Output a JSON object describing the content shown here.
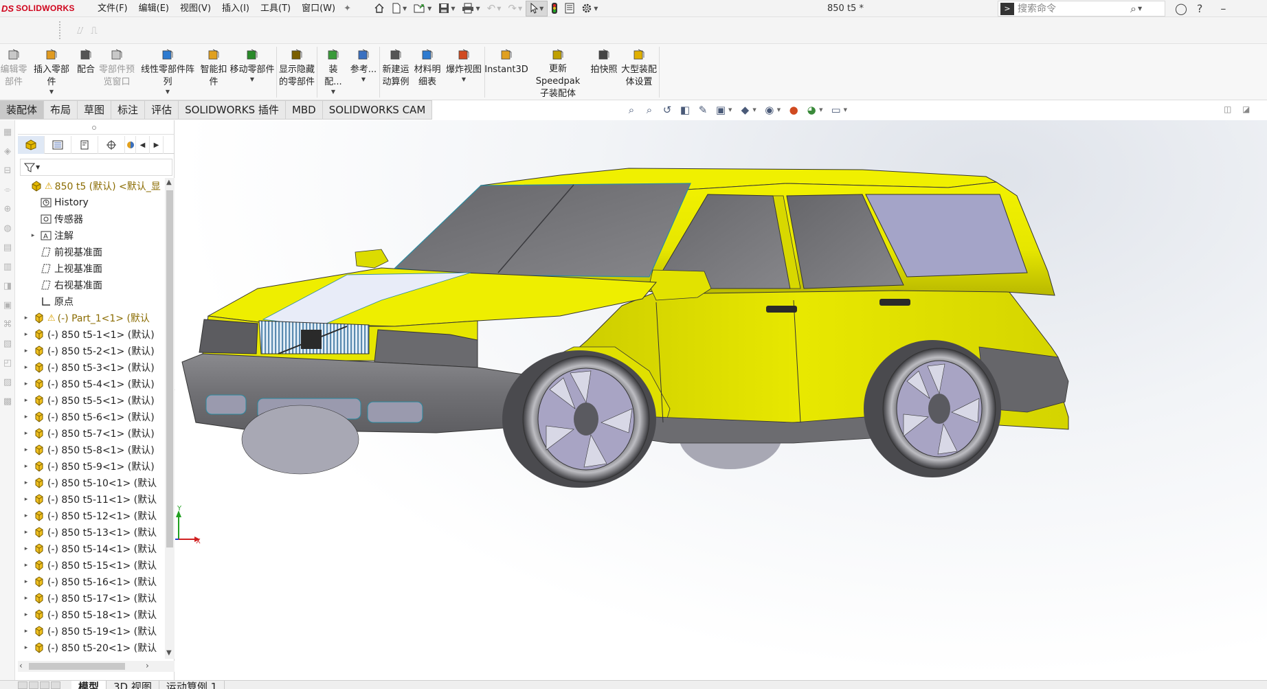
{
  "app": {
    "logo_text": "SOLIDWORKS",
    "logo_mark": "DS"
  },
  "menu": [
    "文件(F)",
    "编辑(E)",
    "视图(V)",
    "插入(I)",
    "工具(T)",
    "窗口(W)"
  ],
  "doc_title": "850 t5 *",
  "search": {
    "placeholder": "搜索命令"
  },
  "ribbon": [
    {
      "label": "编辑零\n部件",
      "disabled": true,
      "icon": "edit-component-icon"
    },
    {
      "label": "插入零部件",
      "dropdown": true,
      "icon": "insert-component-icon"
    },
    {
      "label": "配合",
      "icon": "mate-icon"
    },
    {
      "label": "零部件预\n览窗口",
      "disabled": true,
      "icon": "component-preview-icon"
    },
    {
      "label": "线性零部件阵列",
      "dropdown": true,
      "icon": "linear-pattern-icon"
    },
    {
      "label": "智能扣\n件",
      "icon": "smart-fasteners-icon"
    },
    {
      "label": "移动零部件",
      "dropdown": true,
      "icon": "move-component-icon"
    },
    {
      "label": "显示隐藏\n的零部件",
      "icon": "show-hidden-icon"
    },
    {
      "label": "装配...",
      "dropdown": true,
      "icon": "assembly-features-icon"
    },
    {
      "label": "参考...",
      "dropdown": true,
      "icon": "reference-geometry-icon"
    },
    {
      "label": "新建运\n动算例",
      "icon": "new-motion-study-icon"
    },
    {
      "label": "材料明\n细表",
      "icon": "bom-icon"
    },
    {
      "label": "爆炸视图",
      "dropdown": true,
      "icon": "exploded-view-icon"
    },
    {
      "label": "Instant3D",
      "icon": "instant3d-icon"
    },
    {
      "label": "更新 Speedpak\n子装配体",
      "icon": "speedpak-icon"
    },
    {
      "label": "拍快照",
      "icon": "snapshot-icon"
    },
    {
      "label": "大型装配\n体设置",
      "icon": "large-assembly-icon"
    }
  ],
  "tabs": [
    "装配体",
    "布局",
    "草图",
    "标注",
    "评估",
    "SOLIDWORKS 插件",
    "MBD",
    "SOLIDWORKS CAM"
  ],
  "tree": {
    "root": "850 t5 (默认) <默认_显",
    "items": [
      {
        "label": "History",
        "icon": "history-icon"
      },
      {
        "label": "传感器",
        "icon": "sensor-icon"
      },
      {
        "label": "注解",
        "icon": "annotation-icon",
        "expandable": true
      },
      {
        "label": "前视基准面",
        "icon": "plane-icon"
      },
      {
        "label": "上视基准面",
        "icon": "plane-icon"
      },
      {
        "label": "右视基准面",
        "icon": "plane-icon"
      },
      {
        "label": "原点",
        "icon": "origin-icon"
      }
    ],
    "parts": [
      "(-) Part_1<1> (默认",
      "(-) 850 t5-1<1> (默认)",
      "(-) 850 t5-2<1> (默认)",
      "(-) 850 t5-3<1> (默认)",
      "(-) 850 t5-4<1> (默认)",
      "(-) 850 t5-5<1> (默认)",
      "(-) 850 t5-6<1> (默认)",
      "(-) 850 t5-7<1> (默认)",
      "(-) 850 t5-8<1> (默认)",
      "(-) 850 t5-9<1> (默认)",
      "(-) 850 t5-10<1> (默认",
      "(-) 850 t5-11<1> (默认",
      "(-) 850 t5-12<1> (默认",
      "(-) 850 t5-13<1> (默认",
      "(-) 850 t5-14<1> (默认",
      "(-) 850 t5-15<1> (默认",
      "(-) 850 t5-16<1> (默认",
      "(-) 850 t5-17<1> (默认",
      "(-) 850 t5-18<1> (默认",
      "(-) 850 t5-19<1> (默认",
      "(-) 850 t5-20<1> (默认"
    ]
  },
  "bottom_tabs": [
    "模型",
    "3D 视图",
    "运动算例 1"
  ],
  "triad": {
    "x": "X",
    "y": "Y",
    "z": "Z"
  },
  "colors": {
    "body": "#e8e800",
    "glass": "#7a7a7e",
    "rear_glass": "#a8a8cc",
    "bumper": "#7c7c80",
    "grille": "#7aa8c8",
    "hood_stripe": "#e8ecf8"
  }
}
